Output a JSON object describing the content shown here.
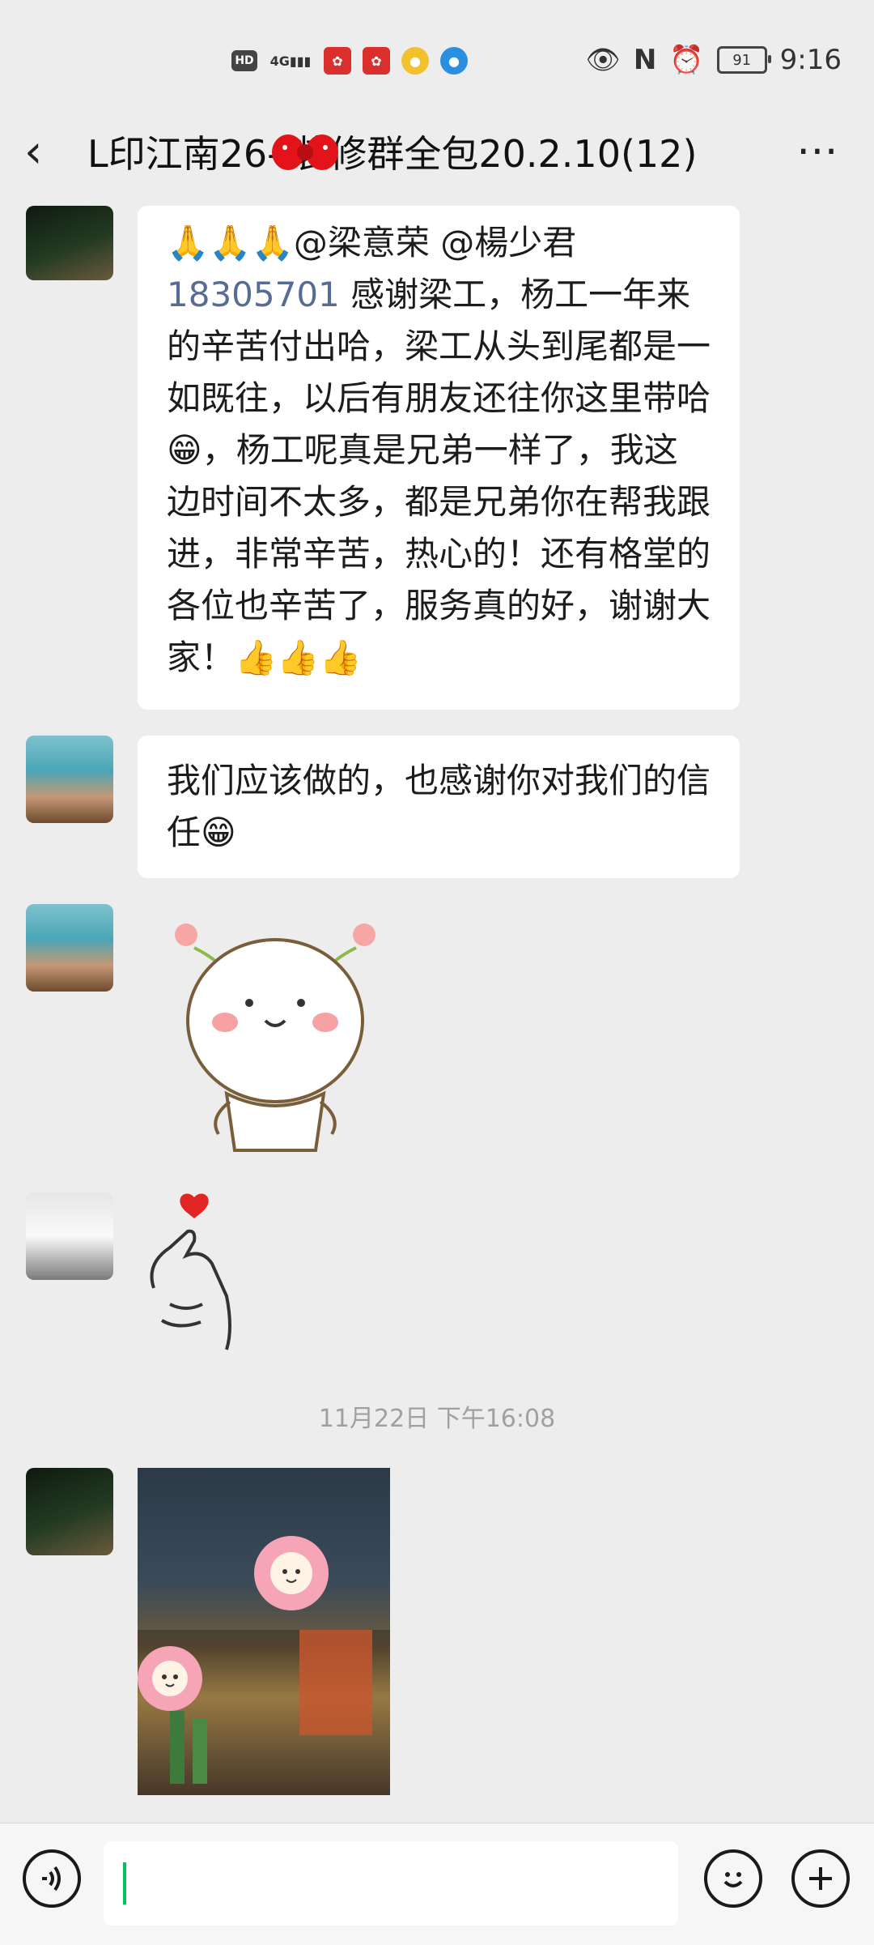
{
  "status_bar": {
    "left_icons": [
      "hd-icon",
      "4g-signal-icon",
      "red-app-icon",
      "red-app-icon",
      "yellow-app-icon",
      "blue-app-icon"
    ],
    "hd_label": "HD",
    "net_label": "4G",
    "battery": "91",
    "time": "9:16"
  },
  "header": {
    "title": "L印江南26-    装修群全包20.2.10(12)"
  },
  "messages": [
    {
      "type": "text",
      "mentions": "@梁意荣 @楊少君",
      "mention_number": "18305701",
      "body": "感谢梁工，杨工一年来的辛苦付出哈，梁工从头到尾都是一如既往，以后有朋友还往你这里带哈😁，杨工呢真是兄弟一样了，我这边时间不太多，都是兄弟你在帮我跟进，非常辛苦，热心的！还有格堂的各位也辛苦了，服务真的好，谢谢大家！👍👍👍",
      "prefix_emoji": "🙏🙏🙏"
    },
    {
      "type": "text",
      "body": "我们应该做的，也感谢你对我们的信任😁"
    },
    {
      "type": "sticker",
      "name": "cute-character"
    },
    {
      "type": "sticker",
      "name": "finger-heart"
    }
  ],
  "timestamp": "11月22日 下午16:08",
  "composer": {
    "voice_icon": "voice-icon",
    "emoji_icon": "emoji-icon",
    "plus_icon": "plus-icon"
  }
}
